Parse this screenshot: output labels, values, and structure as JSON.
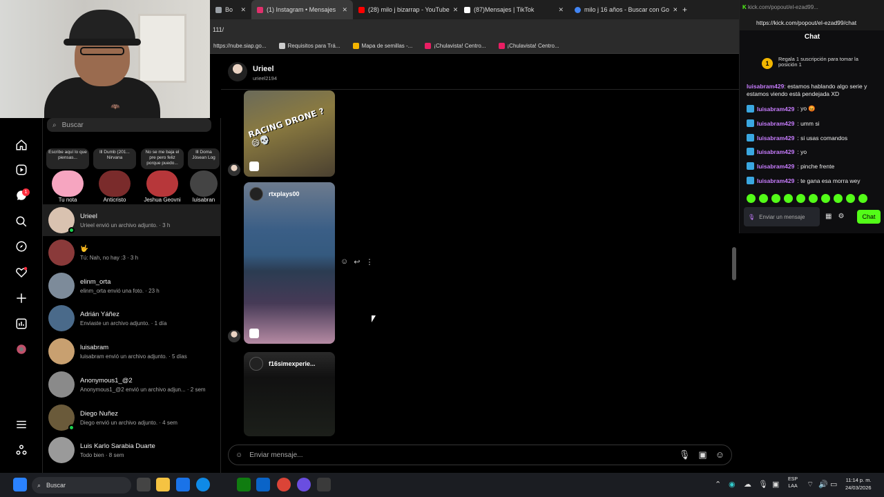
{
  "browser": {
    "tabs": [
      {
        "label": "Bo",
        "color": "#9aa0a6"
      },
      {
        "label": "(1) Instagram • Mensajes",
        "color": "#e1306c",
        "active": true
      },
      {
        "label": "(28) milo j bizarrap - YouTube",
        "color": "#ff0000"
      },
      {
        "label": "(87)Mensajes | TikTok",
        "color": "#ffffff"
      },
      {
        "label": "milo j 16 años - Buscar con Go",
        "color": "#4285f4"
      }
    ],
    "new_tab": "+",
    "address": "111/",
    "bookmarks": [
      {
        "label": "https://nube.siap.go...",
        "color": "#1a73e8"
      },
      {
        "label": "Requisitos para Trá...",
        "color": "#cccccc"
      },
      {
        "label": "Mapa de semillas -...",
        "color": "#f4b400"
      },
      {
        "label": "¡Chulavista! Centro...",
        "color": "#e91e63"
      },
      {
        "label": "¡Chulavista! Centro...",
        "color": "#e91e63"
      }
    ]
  },
  "webcam": {
    "shirt_logo": "BATMAN"
  },
  "inbox": {
    "search_placeholder": "Buscar",
    "notes": [
      {
        "bubble": "Escribe aquí lo que piensas...",
        "name": "Tu nota",
        "color": "#f6a5c0"
      },
      {
        "bubble": "lll Dumb (201... Nirvana",
        "name": "Anticristo",
        "color": "#7a2b2b"
      },
      {
        "bubble": "No se me baja el pre pero feliz porque puedo...",
        "name": "Jeshua Geovni",
        "color": "#b7373a"
      },
      {
        "bubble": "lll Doma Jósean Log",
        "name": "luisabran",
        "color": "#444444"
      }
    ],
    "conversations": [
      {
        "name": "Urieel",
        "last": "Urieel envió un archivo adjunto. · 3 h",
        "online": true,
        "selected": true,
        "color": "#d9c2b0"
      },
      {
        "name": "🤟",
        "last": "Tú: Nah, no hay :3 · 3 h",
        "online": false,
        "selected": false,
        "color": "#8a3a3a"
      },
      {
        "name": "elinm_orta",
        "last": "elinm_orta envió una foto. · 23 h",
        "online": false,
        "selected": false,
        "color": "#7d8b9a"
      },
      {
        "name": "Adrián Yáñez",
        "last": "Enviaste un archivo adjunto. · 1 día",
        "online": false,
        "selected": false,
        "color": "#4a6a8a"
      },
      {
        "name": "luisabram",
        "last": "luisabram envió un archivo adjunto. · 5 días",
        "online": false,
        "selected": false,
        "color": "#c8a070"
      },
      {
        "name": "Anonymous1_@2",
        "last": "Anonymous1_@2 envió un archivo adjun... · 2 sem",
        "online": false,
        "selected": false,
        "color": "#8a8a8a"
      },
      {
        "name": "Diego Nuñez",
        "last": "Diego envió un archivo adjunto. · 4 sem",
        "online": true,
        "selected": false,
        "color": "#6a5a3a"
      },
      {
        "name": "Luis Karlo Sarabia Duarte",
        "last": "Todo bien · 8 sem",
        "online": false,
        "selected": false,
        "color": "#9a9a9a"
      }
    ]
  },
  "chat": {
    "name": "Urieel",
    "username": "urieel2194",
    "reel1_text": "RACING DRONE ? 😄💀",
    "reel2_user": "rtxplays00",
    "reel3_user": "f16simexperie...",
    "composer_placeholder": "Enviar mensaje...",
    "actions": [
      "☺",
      "↩",
      "⋮"
    ]
  },
  "kick": {
    "tab_url": "kick.com/popout/el-ezad99...",
    "url": "https://kick.com/popout/el-ezad99/chat",
    "title": "Chat",
    "sub_banner": "Regala 1 suscripción para tomar la posición 1",
    "sub_rank": "1",
    "messages": [
      {
        "user": "luisabram429",
        "text": ": estamos hablando algo serie y estamos viendo está pendejada XD",
        "partial": true
      },
      {
        "user": "luisabram429",
        "text": ": yo 😡"
      },
      {
        "user": "luisabram429",
        "text": ": umm si"
      },
      {
        "user": "luisabram429",
        "text": ": si usas comandos"
      },
      {
        "user": "luisabram429",
        "text": ": yo"
      },
      {
        "user": "luisabram429",
        "text": ": pinche frente"
      },
      {
        "user": "luisabram429",
        "text": ": te gana esa morra wey"
      }
    ],
    "input_placeholder": "Enviar un mensaje",
    "send_label": "Chat",
    "accent": "#53fc18"
  },
  "taskbar": {
    "search_placeholder": "Buscar",
    "lang": "ESP",
    "lang2": "LAA",
    "time": "11:14 p. m.",
    "date": "24/03/2026"
  }
}
